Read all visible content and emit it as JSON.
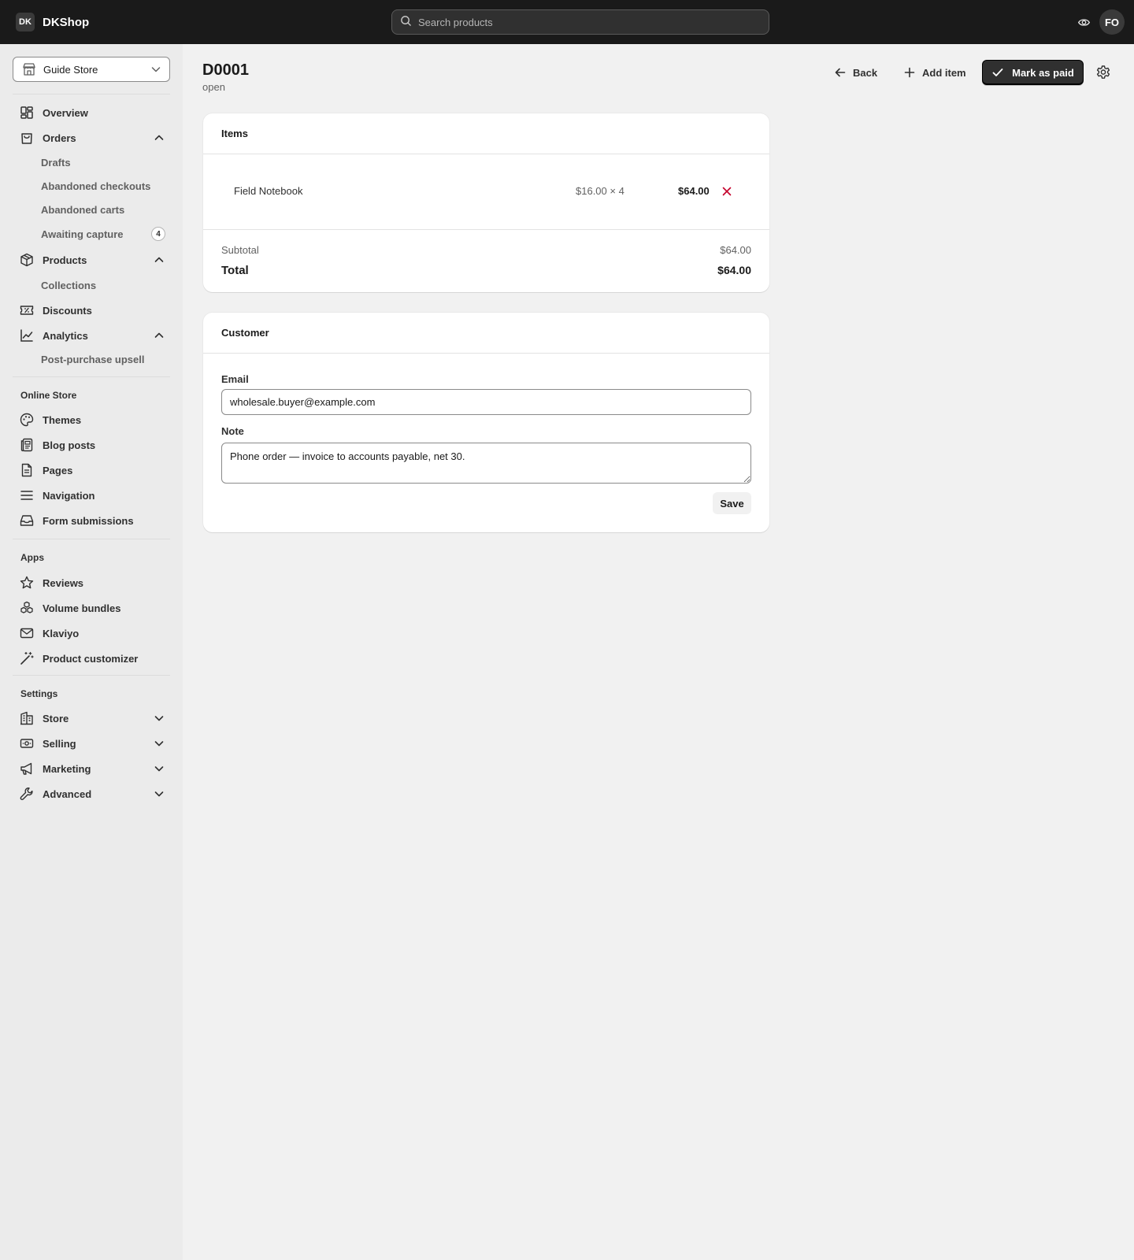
{
  "brand": {
    "logo": "DK",
    "name": "DKShop"
  },
  "search": {
    "placeholder": "Search products"
  },
  "user": {
    "initials": "FO"
  },
  "sidebar": {
    "store": "Guide Store",
    "nav": {
      "overview": "Overview",
      "orders": "Orders",
      "orders_sub": {
        "drafts": "Drafts",
        "abandoned_checkouts": "Abandoned checkouts",
        "abandoned_carts": "Abandoned carts",
        "awaiting_capture": "Awaiting capture",
        "awaiting_capture_count": "4"
      },
      "products": "Products",
      "products_sub": {
        "collections": "Collections"
      },
      "discounts": "Discounts",
      "analytics": "Analytics",
      "analytics_sub": {
        "post_purchase_upsell": "Post-purchase upsell"
      }
    },
    "online_store": {
      "label": "Online Store",
      "themes": "Themes",
      "blog_posts": "Blog posts",
      "pages": "Pages",
      "navigation": "Navigation",
      "form_submissions": "Form submissions"
    },
    "apps": {
      "label": "Apps",
      "reviews": "Reviews",
      "volume_bundles": "Volume bundles",
      "klaviyo": "Klaviyo",
      "product_customizer": "Product customizer"
    },
    "settings": {
      "label": "Settings",
      "store": "Store",
      "selling": "Selling",
      "marketing": "Marketing",
      "advanced": "Advanced"
    }
  },
  "page": {
    "title": "D0001",
    "status": "open",
    "actions": {
      "back": "Back",
      "add_item": "Add item",
      "mark_paid": "Mark as paid"
    }
  },
  "items_card": {
    "title": "Items",
    "items": [
      {
        "name": "Field Notebook",
        "unit_price": "$16.00 × 4",
        "total": "$64.00"
      }
    ],
    "subtotal_label": "Subtotal",
    "subtotal": "$64.00",
    "total_label": "Total",
    "total": "$64.00"
  },
  "customer_card": {
    "title": "Customer",
    "email_label": "Email",
    "email": "wholesale.buyer@example.com",
    "note_label": "Note",
    "note": "Phone order — invoice to accounts payable, net 30.",
    "save": "Save"
  },
  "colors": {
    "topbar": "#1a1a1a",
    "primary": "#303030",
    "remove": "#c4002b",
    "background": "#f1f1f1"
  }
}
